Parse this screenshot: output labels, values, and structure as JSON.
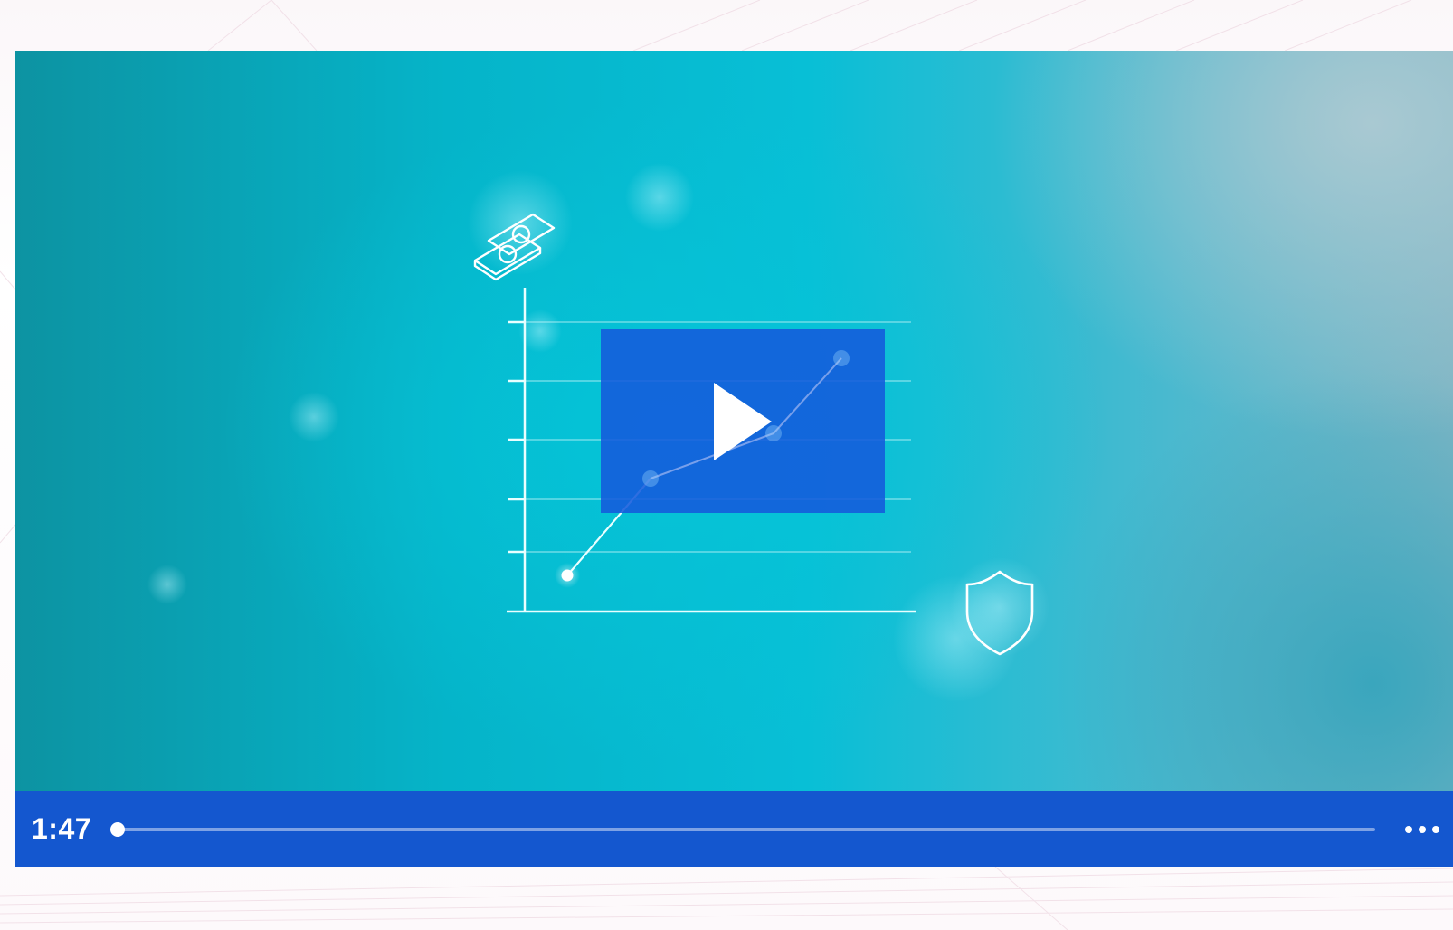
{
  "player": {
    "current_time": "1:47",
    "progress_fraction": 0.0,
    "accent_color": "#1457cf",
    "video_bg_color": "#05bfd4",
    "play_icon": "play-icon",
    "more_icon": "more-horizontal-icon"
  },
  "video_art": {
    "icons": [
      "euro-banknotes-icon",
      "line-chart-icon",
      "shield-icon"
    ]
  }
}
